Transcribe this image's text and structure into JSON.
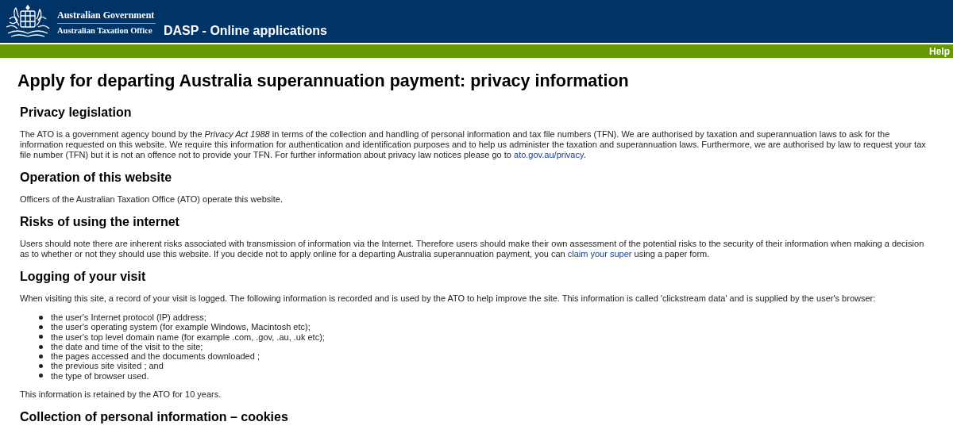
{
  "header": {
    "government": "Australian Government",
    "office": "Australian Taxation Office",
    "app_title": "DASP - Online applications"
  },
  "nav": {
    "help": "Help"
  },
  "title": "Apply for departing Australia superannuation payment: privacy information",
  "sections": [
    {
      "heading": "Privacy legislation",
      "blocks": [
        {
          "kind": "paragraph",
          "text": "The ATO is a government agency bound by the *Privacy Act 1988* in terms of the collection and handling of personal information and tax file numbers (TFN). We are authorised by taxation and superannuation laws to ask for the information requested on this website. We require this information for authentication and identification purposes and to help us administer the taxation and superannuation laws. Furthermore, we are authorised by law to request your tax file number (TFN) but it is not an offence not to provide your TFN. For further information about privacy law notices please go to",
          "link": "ato.gov.au/privacy",
          "after": "."
        }
      ]
    },
    {
      "heading": "Operation of this website",
      "blocks": [
        {
          "kind": "paragraph",
          "text": "Officers of the Australian Taxation Office (ATO) operate this website."
        }
      ]
    },
    {
      "heading": "Risks of using the internet",
      "blocks": [
        {
          "kind": "paragraph",
          "text": "Users should note there are inherent risks associated with transmission of information via the Internet. Therefore users should make their own assessment of the potential risks to the security of their information when making a decision as to whether or not they should use this website. If you decide not to apply online for a departing Australia superannuation payment, you can",
          "link": "claim your super",
          "after": "using a paper form."
        }
      ]
    },
    {
      "heading": "Logging of your visit",
      "blocks": [
        {
          "kind": "paragraph",
          "text": "When visiting this site, a record of your visit is logged. The following information is recorded and is used by the ATO to help improve the site. This information is called 'clickstream data' and is supplied by the user's browser:"
        },
        {
          "kind": "list",
          "items": [
            "the user's Internet protocol (IP) address;",
            "the user's operating system (for example Windows, Macintosh etc);",
            "the user's top level domain name (for example .com, .gov, .au, .uk etc);",
            "the date and time of the visit to the site;",
            "the pages accessed and the documents downloaded ;",
            "the previous site visited ; and",
            "the type of browser used."
          ]
        },
        {
          "kind": "paragraph",
          "text": "This information is retained by the ATO for 10 years."
        }
      ]
    },
    {
      "heading": "Collection of personal information – cookies"
    }
  ]
}
